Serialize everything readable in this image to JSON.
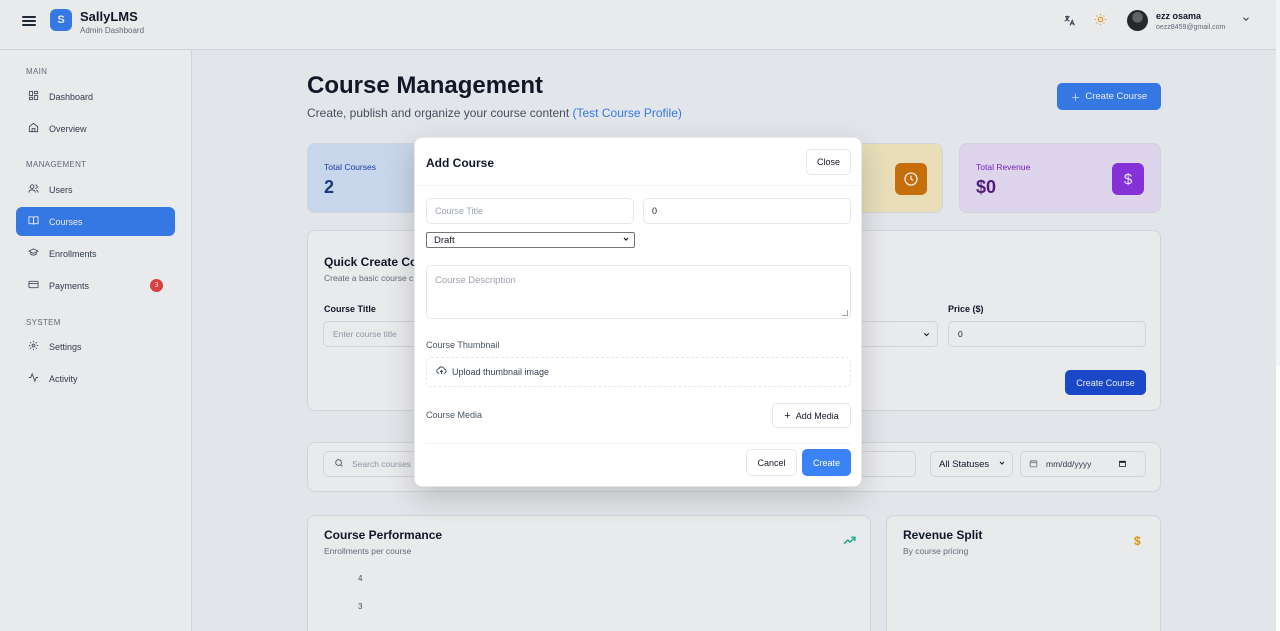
{
  "app": {
    "brand_initial": "S",
    "brand_name": "SallyLMS",
    "brand_subtitle": "Admin Dashboard"
  },
  "header": {
    "translate_icon": "translate-icon",
    "theme_icon": "sun-icon",
    "user_name": "ezz osama",
    "user_email": "oezz8459@gmail.com"
  },
  "sidebar": {
    "sections": {
      "main": "MAIN",
      "management": "MANAGEMENT",
      "system": "SYSTEM"
    },
    "items": {
      "dashboard": "Dashboard",
      "overview": "Overview",
      "users": "Users",
      "courses": "Courses",
      "enrollments": "Enrollments",
      "payments": "Payments",
      "payments_badge": "3",
      "settings": "Settings",
      "activity": "Activity"
    },
    "active_item": "Courses"
  },
  "page": {
    "title": "Course Management",
    "subtitle": "Create, publish and organize your course content",
    "subtitle_link": "(Test Course Profile)",
    "create_button": "Create Course"
  },
  "stats": {
    "total_courses_label": "Total Courses",
    "total_courses_value": "2",
    "total_revenue_label": "Total Revenue",
    "total_revenue_value": "$0"
  },
  "quick_create": {
    "title": "Quick Create Cou",
    "subtitle": "Create a basic course c",
    "course_title_label": "Course Title",
    "course_title_placeholder": "Enter course title",
    "price_label": "Price ($)",
    "price_value": "0",
    "create_button": "Create Course"
  },
  "filters": {
    "search_placeholder": "Search courses",
    "status_selected": "All Statuses",
    "date_placeholder": "mm/dd/yyyy"
  },
  "charts": {
    "performance_title": "Course Performance",
    "performance_subtitle": "Enrollments per course",
    "revenue_title": "Revenue Split",
    "revenue_subtitle": "By course pricing"
  },
  "chart_data": {
    "type": "bar",
    "title": "Course Performance",
    "subtitle": "Enrollments per course",
    "y_ticks": [
      "4",
      "3"
    ],
    "series": []
  },
  "modal": {
    "title": "Add Course",
    "close_button": "Close",
    "course_title_placeholder": "Course Title",
    "price_value": "0",
    "status_selected": "Draft",
    "description_placeholder": "Course Description",
    "thumbnail_label": "Course Thumbnail",
    "upload_label": "Upload thumbnail image",
    "media_label": "Course Media",
    "add_media_button": "Add Media",
    "cancel_button": "Cancel",
    "create_button": "Create"
  },
  "colors": {
    "primary": "#3b82f6",
    "primary_dark": "#1d4ed8",
    "badge_red": "#ef4444",
    "amber": "#f59e0b",
    "purple": "#a855f7",
    "trend_green": "#10b981"
  }
}
